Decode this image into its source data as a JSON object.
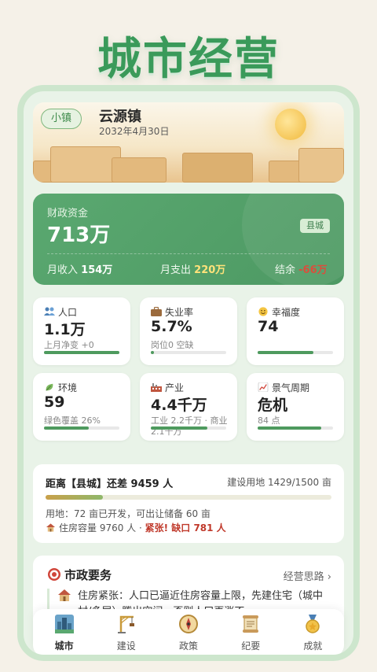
{
  "app_title": "城市经营",
  "header": {
    "level_chip": "小镇",
    "town_name": "云源镇",
    "date": "2032年4月30日"
  },
  "finance": {
    "label": "财政资金",
    "value": "713万",
    "badge": "县城",
    "income_label": "月收入",
    "income": "154万",
    "expense_label": "月支出",
    "expense": "220万",
    "balance_label": "结余",
    "balance": "-66万"
  },
  "stats": [
    {
      "icon": "people-icon",
      "label": "人口",
      "value": "1.1万",
      "sub": "上月净变 +0",
      "progress": 1.0
    },
    {
      "icon": "briefcase-icon",
      "label": "失业率",
      "value": "5.7%",
      "sub": "岗位0 空缺",
      "progress": 0.04
    },
    {
      "icon": "smile-icon",
      "label": "幸福度",
      "value": "74",
      "sub": "",
      "progress": 0.74
    },
    {
      "icon": "leaf-icon",
      "label": "环境",
      "value": "59",
      "sub": "绿色覆盖 26%",
      "progress": 0.59
    },
    {
      "icon": "factory-icon",
      "label": "产业",
      "value": "4.4千万",
      "sub": "工业 2.2千万 · 商业 2.1千万",
      "progress": 0.75
    },
    {
      "icon": "chart-icon",
      "label": "景气周期",
      "value": "危机",
      "sub": "84 点",
      "progress": 0.84
    }
  ],
  "goal": {
    "title": "距离【县城】还差 9459 人",
    "land": "建设用地 1429/1500 亩",
    "progress": 0.2,
    "land_line": "用地：72 亩已开发，可出让储备 60 亩",
    "housing_prefix": "住房容量 9760 人 · ",
    "housing_warn": "紧张! 缺口 781 人"
  },
  "affairs": {
    "title": "市政要务",
    "link": "经营思路 ›",
    "text": "住房紧张：人口已逼近住房容量上限，先建住宅（城中村/多层）腾出空间，否则人口再涨不"
  },
  "nav": [
    {
      "label": "城市",
      "icon": "city-icon",
      "active": true
    },
    {
      "label": "建设",
      "icon": "crane-icon",
      "active": false
    },
    {
      "label": "政策",
      "icon": "compass-icon",
      "active": false
    },
    {
      "label": "纪要",
      "icon": "scroll-icon",
      "active": false
    },
    {
      "label": "成就",
      "icon": "medal-icon",
      "active": false
    }
  ],
  "colors": {
    "brand": "#3a9a5a",
    "finance_bg": "#5aa870",
    "warn": "#c0392b",
    "expense": "#ffe27a",
    "deficit": "#d94f3d"
  }
}
